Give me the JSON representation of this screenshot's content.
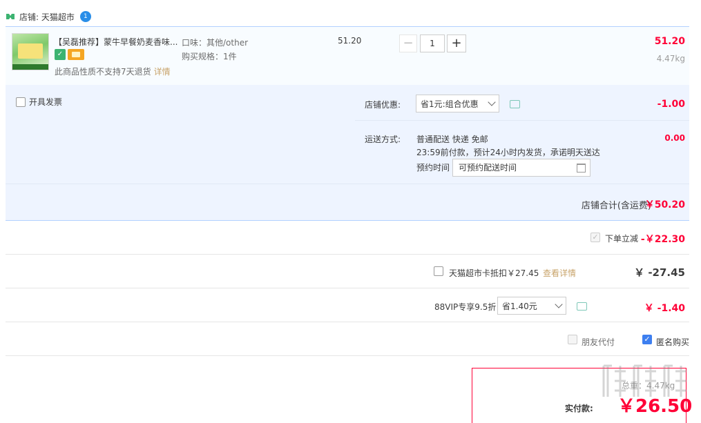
{
  "store": {
    "name": "店铺: 天猫超市",
    "ww_badge": "1"
  },
  "item": {
    "title": "【吴磊推荐】蒙牛早餐奶麦香味...",
    "no_return_text": "此商品性质不支持7天退货",
    "detail_link": "详情",
    "sku_flavor": "口味：其他/other",
    "sku_spec": "购买规格：1件",
    "unit_price": "51.20",
    "quantity": "1",
    "sum_price": "51.20",
    "weight": "4.47kg"
  },
  "options": {
    "invoice_label": "开具发票",
    "coupon_label": "店铺优惠:",
    "coupon_select": "省1元:组合优惠",
    "coupon_amount": "-1.00",
    "shipping_label": "运送方式:",
    "shipping_line1": "普通配送 快递 免邮",
    "shipping_line2": "23:59前付款，预计24小时内发货，承诺明天送达",
    "reserve_label": "预约时间",
    "reserve_placeholder": "可预约配送时间",
    "shipping_amount": "0.00"
  },
  "store_total": {
    "label": "店铺合计(含运费)",
    "amount": "￥50.20"
  },
  "discounts": {
    "instant_label": "下单立减",
    "instant_amount": "-￥22.30",
    "card_label": "天猫超市卡抵扣￥27.45",
    "card_link": "查看详情",
    "card_amount": "￥ -27.45",
    "vip_label": "88VIP专享9.5折",
    "vip_select": "省1.40元",
    "vip_amount": "￥ -1.40"
  },
  "purchase_options": {
    "friend_pay": "朋友代付",
    "anonymous": "匿名购买"
  },
  "payment": {
    "weight": "总重：4.47kg",
    "label": "实付款:",
    "amount": "￥26.50"
  },
  "colors": {
    "accent_red": "#ff0036",
    "panel_blue": "#eef4ff",
    "border_blue": "#b2d1ff",
    "link_gold": "#c8a46b"
  }
}
